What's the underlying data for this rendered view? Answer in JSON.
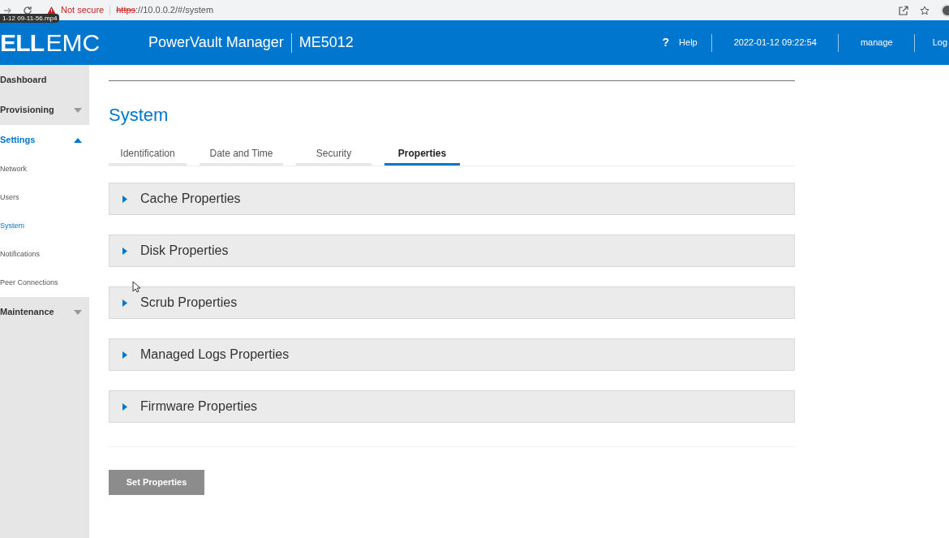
{
  "browser": {
    "security": "Not secure",
    "url_scheme": "https",
    "url_rest": "://10.0.0.2/#/system",
    "tooltip": "1-12 09-11-56.mp4"
  },
  "header": {
    "logo_left": "ELL",
    "logo_right": "EMC",
    "product": "PowerVault Manager",
    "model": "ME5012",
    "help_icon": "?",
    "help": "Help",
    "datetime": "2022-01-12 09:22:54",
    "user": "manage",
    "logout": "Log"
  },
  "sidebar": {
    "items": [
      {
        "label": "Dashboard",
        "kind": "section",
        "selected": false,
        "expanded": false,
        "caret": false
      },
      {
        "label": "Provisioning",
        "kind": "section",
        "selected": false,
        "expanded": false,
        "caret": true
      },
      {
        "label": "Settings",
        "kind": "section",
        "selected": true,
        "expanded": true,
        "caret": true,
        "children": [
          {
            "label": "Network",
            "selected": false
          },
          {
            "label": "Users",
            "selected": false
          },
          {
            "label": "System",
            "selected": true
          },
          {
            "label": "Notifications",
            "selected": false
          },
          {
            "label": "Peer Connections",
            "selected": false
          }
        ]
      },
      {
        "label": "Maintenance",
        "kind": "section",
        "selected": false,
        "expanded": false,
        "caret": true
      }
    ]
  },
  "page": {
    "title": "System",
    "tabs": [
      {
        "label": "Identification",
        "selected": false
      },
      {
        "label": "Date and Time",
        "selected": false
      },
      {
        "label": "Security",
        "selected": false
      },
      {
        "label": "Properties",
        "selected": true
      }
    ],
    "panels": [
      {
        "title": "Cache Properties",
        "expanded": false
      },
      {
        "title": "Disk Properties",
        "expanded": false
      },
      {
        "title": "Scrub Properties",
        "expanded": false
      },
      {
        "title": "Managed Logs Properties",
        "expanded": false
      },
      {
        "title": "Firmware Properties",
        "expanded": false
      }
    ],
    "button": {
      "label": "Set Properties",
      "disabled": true
    }
  }
}
